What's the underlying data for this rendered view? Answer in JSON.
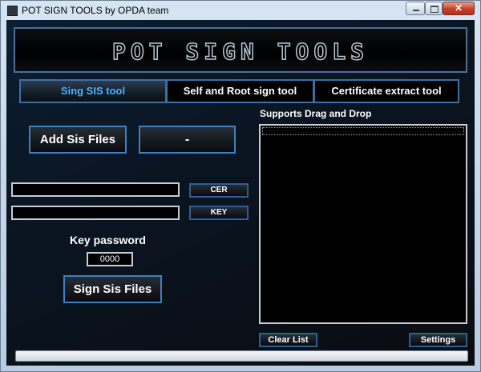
{
  "window": {
    "title": "POT SIGN TOOLS by OPDA team",
    "icon": "app-icon",
    "controls": {
      "minimize": "minimize-icon",
      "maximize": "maximize-icon",
      "close": "close-icon"
    }
  },
  "banner": {
    "title": "POT SIGN TOOLS"
  },
  "tabs": [
    {
      "label": "Sing SIS tool",
      "active": true
    },
    {
      "label": "Self and Root sign tool",
      "active": false
    },
    {
      "label": "Certificate extract tool",
      "active": false
    }
  ],
  "sis_tool": {
    "add_button": "Add Sis Files",
    "remove_button": "-",
    "cer_path": "",
    "cer_button": "CER",
    "key_path": "",
    "key_button": "KEY",
    "password_label": "Key password",
    "password_value": "0000",
    "sign_button": "Sign Sis Files",
    "drag_label": "Supports Drag and Drop",
    "files": [],
    "clear_button": "Clear List",
    "settings_button": "Settings",
    "progress": 0
  },
  "colors": {
    "accent": "#3f7fc4",
    "active_tab_text": "#4ab2ff",
    "background": "#0a1522"
  }
}
